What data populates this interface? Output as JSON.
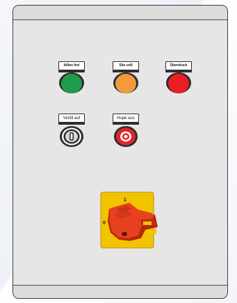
{
  "panel": {
    "lamps": [
      {
        "label": "füllen frei",
        "color": "#1f9c4a"
      },
      {
        "label": "Silo voll",
        "color": "#f39a3c"
      },
      {
        "label": "Überdruck",
        "color": "#ea1c24"
      }
    ],
    "key_switch": {
      "label": "Ventil auf"
    },
    "horn_button": {
      "label": "Hupe aus",
      "color": "#e3242b"
    },
    "main_switch": {
      "position_on": "1",
      "position_off": "0",
      "plate_color": "#f2c400",
      "handle_color": "#e8411f"
    }
  }
}
